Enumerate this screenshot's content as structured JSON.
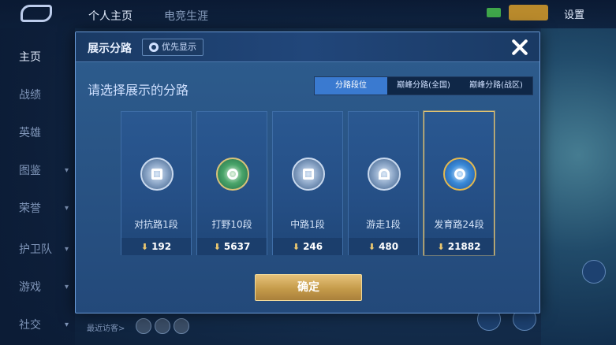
{
  "header": {
    "tabs": [
      {
        "label": "个人主页",
        "active": true
      },
      {
        "label": "电竞生涯",
        "active": false
      }
    ],
    "settings_label": "设置"
  },
  "sidebar": {
    "items": [
      {
        "label": "主页",
        "active": true
      },
      {
        "label": "战绩"
      },
      {
        "label": "英雄"
      },
      {
        "label": "图鉴"
      },
      {
        "label": "荣誉"
      },
      {
        "label": "护卫队"
      },
      {
        "label": "游戏"
      },
      {
        "label": "社交"
      }
    ]
  },
  "footer": {
    "recent_visitors_label": "最近访客>"
  },
  "dialog": {
    "title": "展示分路",
    "priority_label": "优先显示",
    "subtitle": "请选择展示的分路",
    "tabs": [
      {
        "label": "分路段位",
        "active": true
      },
      {
        "label": "巅峰分路(全国)",
        "active": false
      },
      {
        "label": "巅峰分路(战区)",
        "active": false
      }
    ],
    "cards": [
      {
        "name": "对抗路1段",
        "value": "192",
        "icon": "sword-emblem-icon",
        "selected": false
      },
      {
        "name": "打野10段",
        "value": "5637",
        "icon": "jungle-emblem-icon",
        "selected": false
      },
      {
        "name": "中路1段",
        "value": "246",
        "icon": "mid-emblem-icon",
        "selected": false
      },
      {
        "name": "游走1段",
        "value": "480",
        "icon": "roam-emblem-icon",
        "selected": false
      },
      {
        "name": "发育路24段",
        "value": "21882",
        "icon": "farm-emblem-icon",
        "selected": true
      }
    ],
    "confirm_label": "确定"
  },
  "colors": {
    "accent": "#3a7ad0",
    "gold": "#e9c66f",
    "panel": "#2e5d8e"
  }
}
